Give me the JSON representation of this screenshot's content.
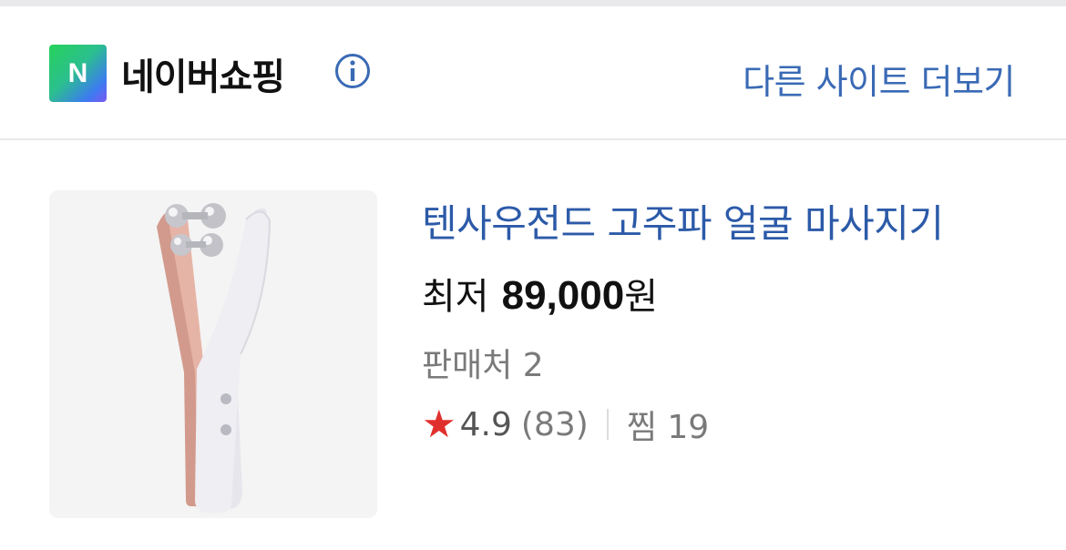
{
  "header": {
    "logo_letter": "N",
    "brand": "네이버쇼핑",
    "info_icon": "info-icon",
    "more_link": "다른 사이트 더보기"
  },
  "product": {
    "image": "face-massager-product-image",
    "title": "텐사우전드 고주파 얼굴 마사지기",
    "price_prefix": "최저",
    "price_amount": "89,000",
    "price_unit": "원",
    "sellers": "판매처 2",
    "rating_icon": "star-icon",
    "rating": "4.9",
    "reviews": "(83)",
    "wishlist": "찜 19"
  },
  "colors": {
    "link_blue": "#3a6ab5",
    "title_blue": "#2c5aa8",
    "star_red": "#e0302e"
  }
}
